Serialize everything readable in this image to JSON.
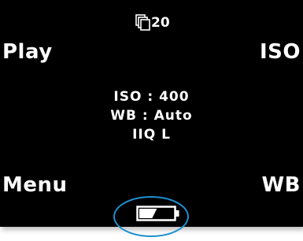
{
  "screen": {
    "background_color": "#000000",
    "text_color": "#ffffff",
    "highlight_color": "#1e8fcf"
  },
  "corners": {
    "top_left": "Play",
    "top_right": "ISO",
    "bottom_left": "Menu",
    "bottom_right": "WB"
  },
  "status": {
    "shots_icon": "stacked-frames-icon",
    "shots_remaining": "20",
    "battery_icon": "battery-icon",
    "battery_level_fraction": 0.45
  },
  "settings": {
    "iso": "ISO : 400",
    "wb": "WB : Auto",
    "quality": "IIQ L"
  }
}
